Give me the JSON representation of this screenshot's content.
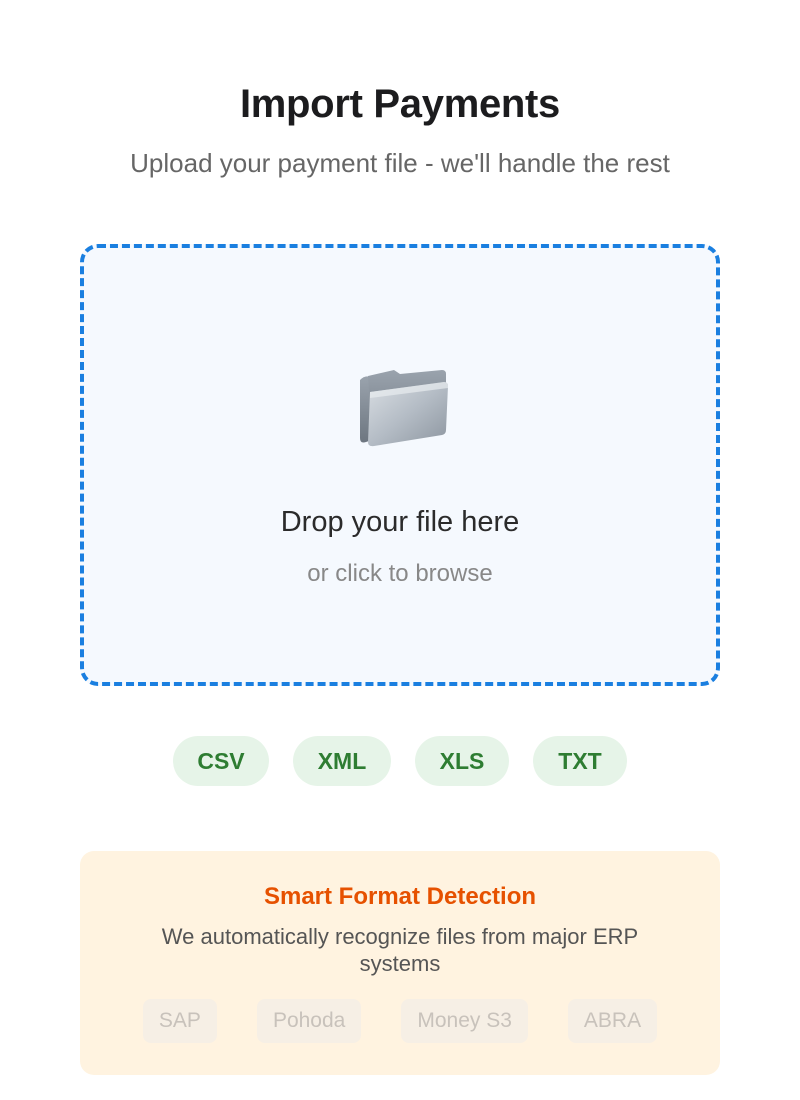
{
  "header": {
    "title": "Import Payments",
    "subtitle": "Upload your payment file - we'll handle the rest"
  },
  "dropzone": {
    "icon": "folder-icon",
    "title": "Drop your file here",
    "subtitle": "or click to browse",
    "border_color": "#1a7fe0",
    "background": "#f5f9fe"
  },
  "formats": [
    "CSV",
    "XML",
    "XLS",
    "TXT"
  ],
  "detection": {
    "title": "Smart Format Detection",
    "description": "We automatically recognize files from major ERP systems",
    "erp_systems": [
      "SAP",
      "Pohoda",
      "Money S3",
      "ABRA"
    ],
    "accent_color": "#e65100",
    "background": "#fff3e0"
  }
}
